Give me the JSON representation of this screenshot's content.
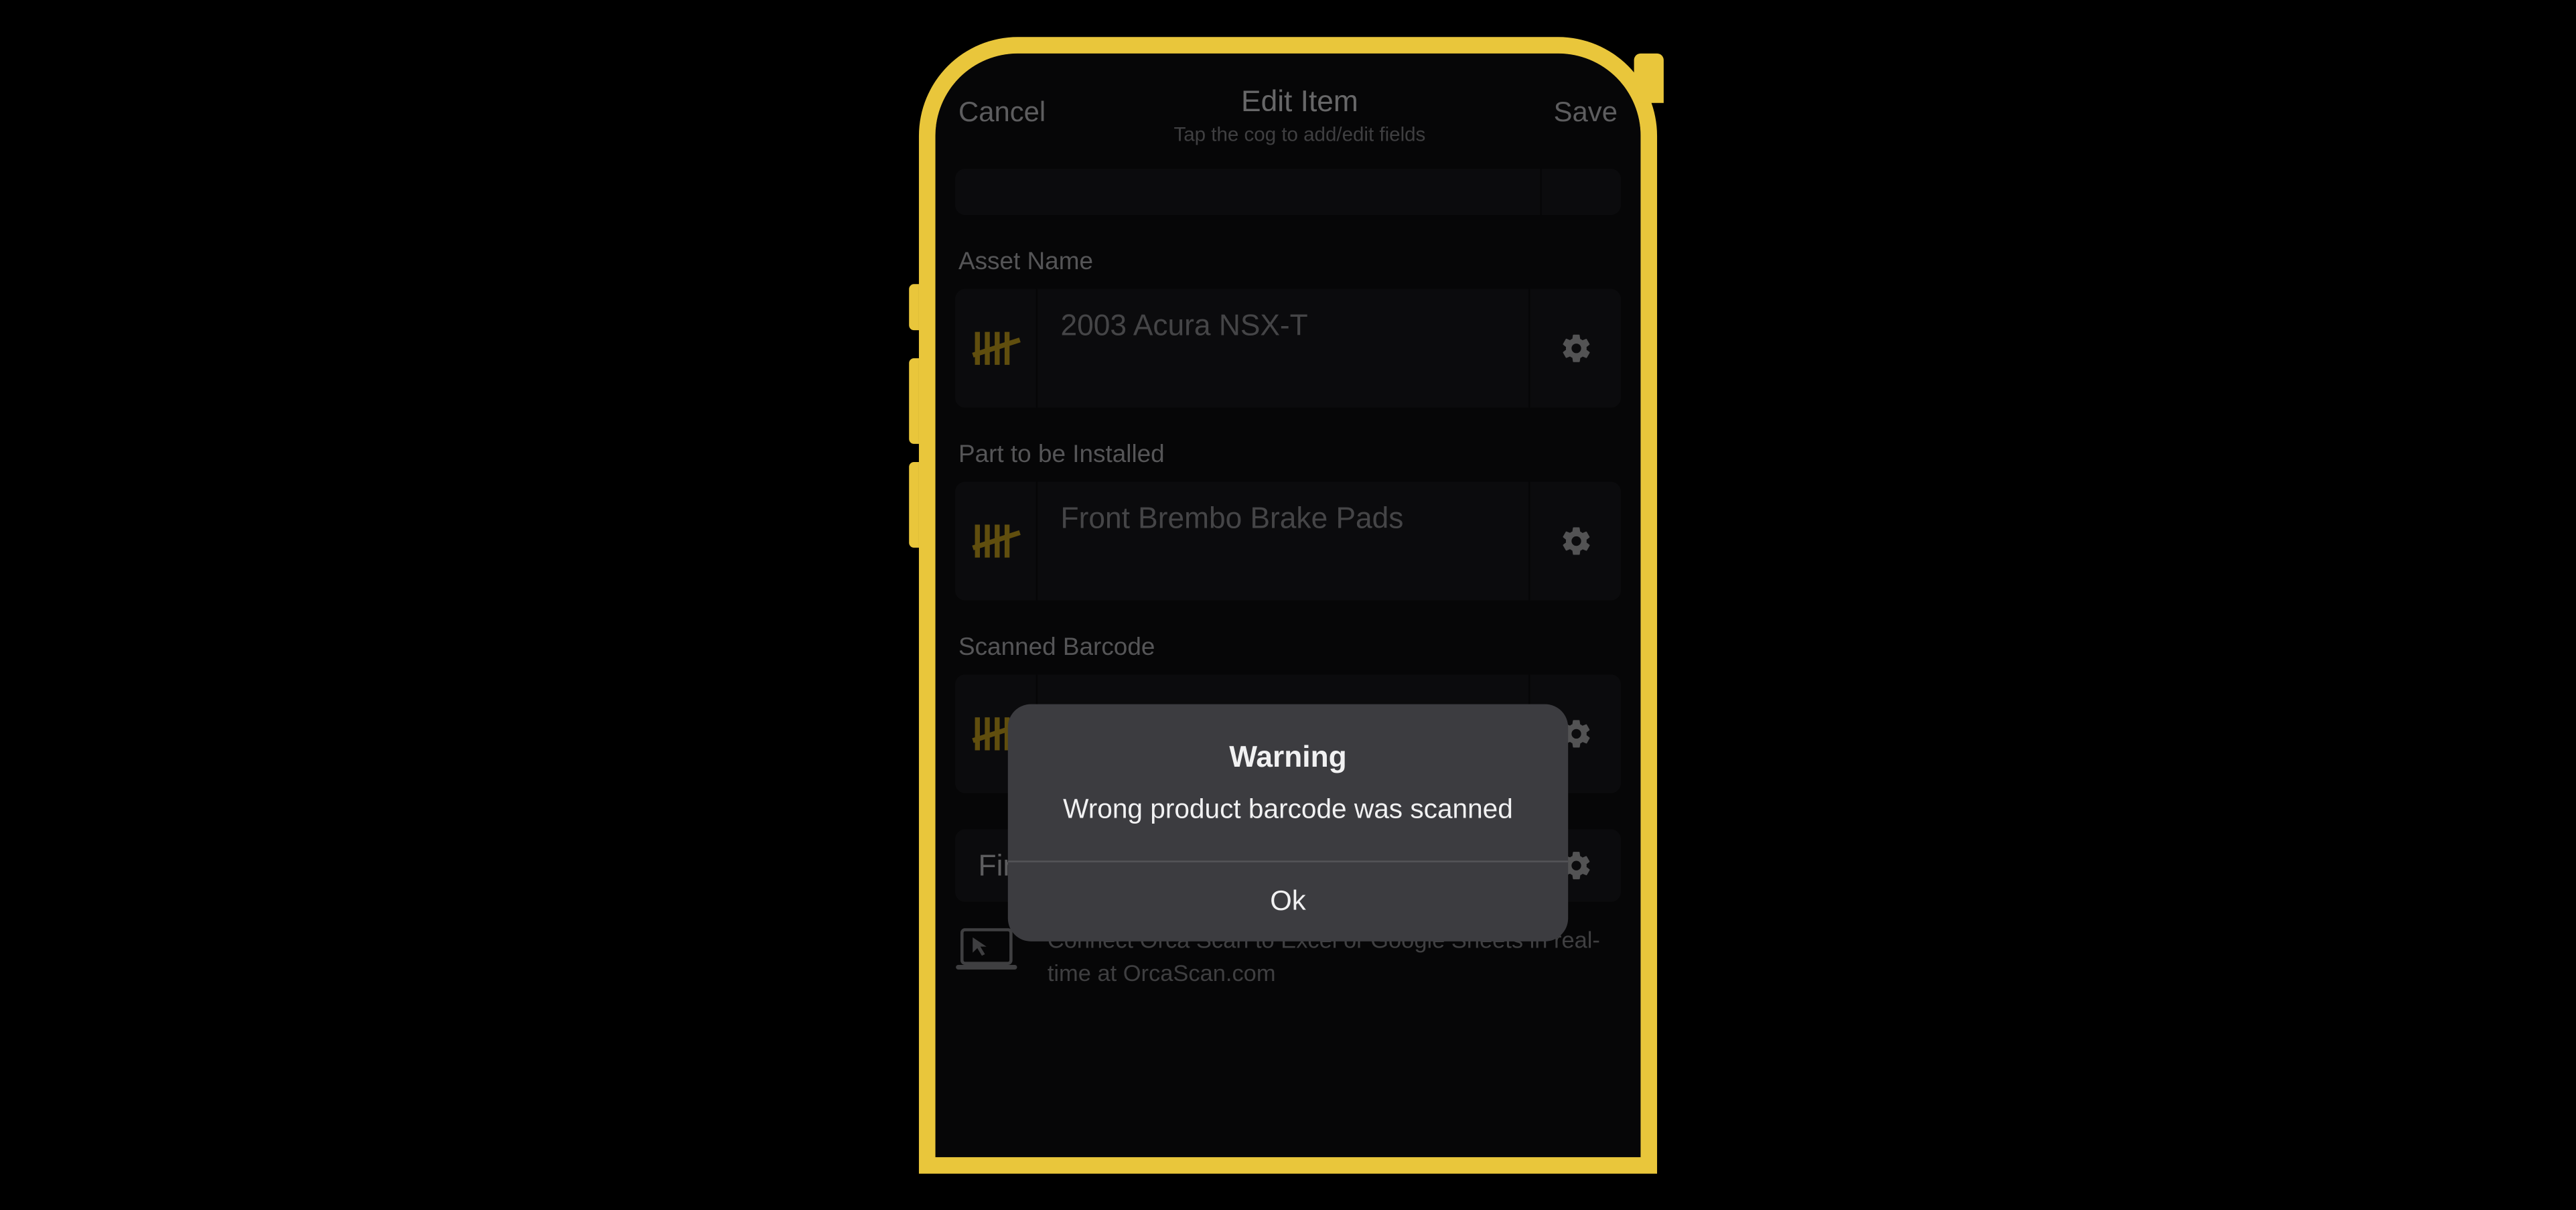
{
  "nav": {
    "cancel": "Cancel",
    "title": "Edit Item",
    "subtitle": "Tap the cog to add/edit fields",
    "save": "Save"
  },
  "fields": [
    {
      "label": "Asset Name",
      "value": "2003 Acura NSX-T"
    },
    {
      "label": "Part to be Installed",
      "value": "Front Brembo Brake Pads"
    },
    {
      "label": "Scanned Barcode",
      "value": ""
    }
  ],
  "finish_row_label": "Finis",
  "footer_text": "Connect Orca Scan to Excel or Google Sheets in real-time at OrcaScan.com",
  "modal": {
    "title": "Warning",
    "message": "Wrong product barcode was scanned",
    "ok": "Ok"
  }
}
